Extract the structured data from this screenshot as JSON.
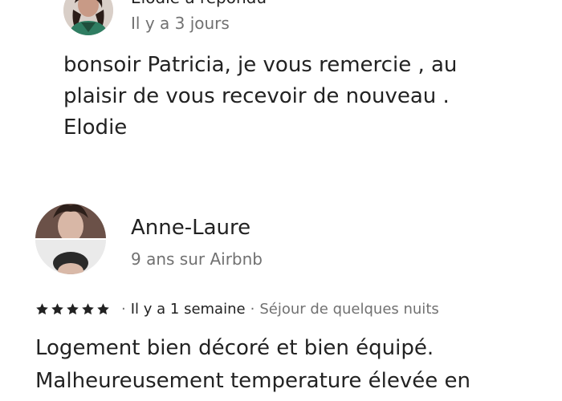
{
  "host_reply": {
    "responder_label": "Elodie a répondu",
    "date": "Il y a 3 jours",
    "text_lines": [
      "bonsoir Patricia,  je vous remercie , au",
      "plaisir de vous recevoir de nouveau .",
      "Elodie"
    ],
    "avatar_icon": "profile-photo-woman"
  },
  "review": {
    "reviewer_name": "Anne-Laure",
    "tenure": "9 ans sur Airbnb",
    "rating_stars": 5,
    "when": "Il y a 1 semaine",
    "stay_type": "Séjour de quelques nuits",
    "separator": "·",
    "text_lines": [
      "Logement bien décoré et bien équipé.",
      "Malheureusement temperature élevée en"
    ],
    "avatar_icon": "profile-photo-split"
  },
  "colors": {
    "text_primary": "#222222",
    "text_secondary": "#717171",
    "star": "#222222"
  }
}
